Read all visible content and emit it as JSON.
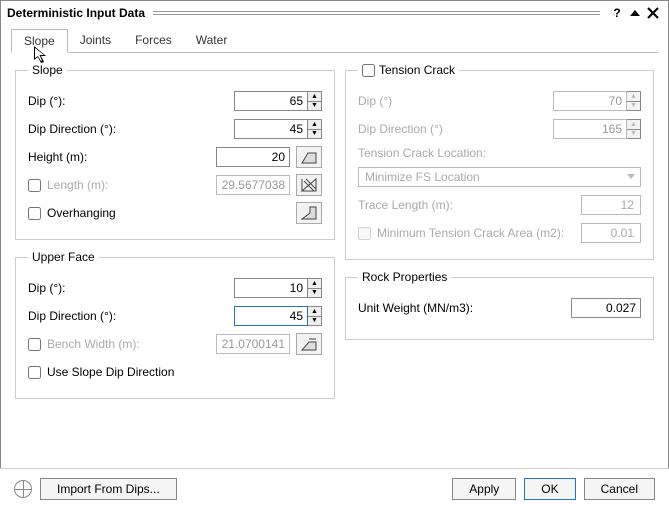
{
  "window": {
    "title": "Deterministic Input Data"
  },
  "tabs": [
    "Slope",
    "Joints",
    "Forces",
    "Water"
  ],
  "active_tab": 0,
  "slope": {
    "legend": "Slope",
    "dip": {
      "label": "Dip (°):",
      "value": "65"
    },
    "dip_dir": {
      "label": "Dip Direction (°):",
      "value": "45"
    },
    "height": {
      "label": "Height (m):",
      "value": "20"
    },
    "length": {
      "label": "Length (m):",
      "value": "29.5677038",
      "checked": false
    },
    "overhanging": {
      "label": "Overhanging",
      "checked": false
    }
  },
  "upper_face": {
    "legend": "Upper Face",
    "dip": {
      "label": "Dip (°):",
      "value": "10"
    },
    "dip_dir": {
      "label": "Dip Direction (°):",
      "value": "45"
    },
    "bench": {
      "label": "Bench Width (m):",
      "value": "21.0700141",
      "checked": false
    },
    "use_slope_dd": {
      "label": "Use Slope Dip Direction",
      "checked": false
    }
  },
  "tension_crack": {
    "legend": "Tension Crack",
    "enabled": false,
    "dip": {
      "label": "Dip (°)",
      "value": "70"
    },
    "dip_dir": {
      "label": "Dip Direction (°)",
      "value": "165"
    },
    "location_label": "Tension Crack Location:",
    "location_value": "Minimize FS Location",
    "trace": {
      "label": "Trace Length (m):",
      "value": "12"
    },
    "min_area": {
      "label": "Minimum Tension Crack Area (m2):",
      "value": "0.01"
    }
  },
  "rock_props": {
    "legend": "Rock Properties",
    "unit_weight": {
      "label": "Unit Weight (MN/m3):",
      "value": "0.027"
    }
  },
  "footer": {
    "import": "Import From Dips...",
    "apply": "Apply",
    "ok": "OK",
    "cancel": "Cancel"
  }
}
